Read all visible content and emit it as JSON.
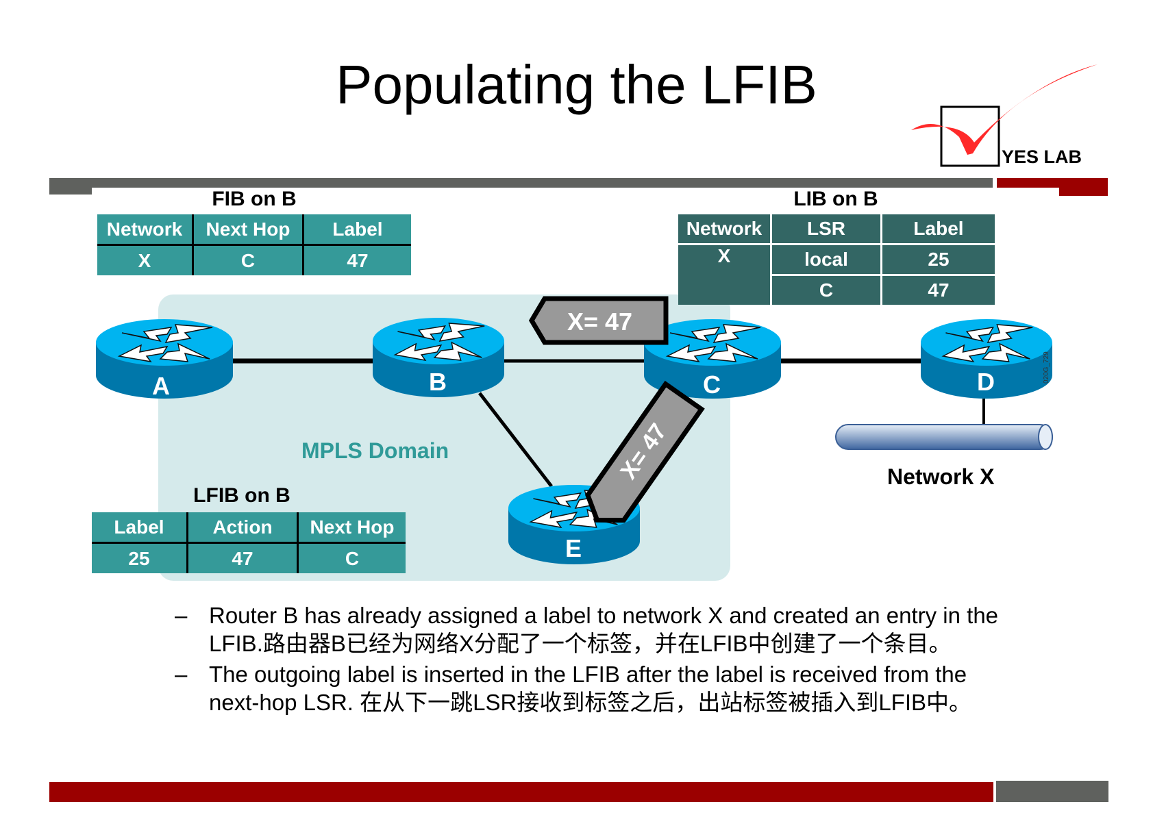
{
  "title": "Populating the LFIB",
  "logo": {
    "text": "YES LAB",
    "check_color": "#ff2a2a"
  },
  "colors": {
    "bar_gray": "#5f615e",
    "bar_red": "#9b0000",
    "teal": "#359a99",
    "dark_teal": "#336664",
    "domain_bg": "#d5eaeb",
    "router_top": "#00b4f0",
    "router_side": "#0077aa"
  },
  "fib": {
    "title": "FIB on B",
    "headers": [
      "Network",
      "Next Hop",
      "Label"
    ],
    "rows": [
      [
        "X",
        "C",
        "47"
      ]
    ]
  },
  "lib": {
    "title": "LIB on B",
    "headers": [
      "Network",
      "LSR",
      "Label"
    ],
    "network": "X",
    "rows": [
      [
        "local",
        "25"
      ],
      [
        "C",
        "47"
      ]
    ]
  },
  "lfib": {
    "title": "LFIB on B",
    "headers": [
      "Label",
      "Action",
      "Next Hop"
    ],
    "rows": [
      [
        "25",
        "47",
        "C"
      ]
    ]
  },
  "diagram": {
    "domain_label": "MPLS Domain",
    "routers": [
      "A",
      "B",
      "C",
      "D",
      "E"
    ],
    "network_label": "Network X",
    "label_flag_top": "X= 47",
    "label_flag_diag": "X= 47",
    "figure_id": "020G_729"
  },
  "bullets": [
    {
      "dash": "–",
      "line1": "Router B has already assigned a label to network X and created an entry in the",
      "line2": "LFIB.路由器B已经为网络X分配了一个标签，并在LFIB中创建了一个条目。"
    },
    {
      "dash": "–",
      "line1": "The outgoing label is inserted in the LFIB after the label is received from the",
      "line2": "next-hop LSR. 在从下一跳LSR接收到标签之后，出站标签被插入到LFIB中。"
    }
  ]
}
